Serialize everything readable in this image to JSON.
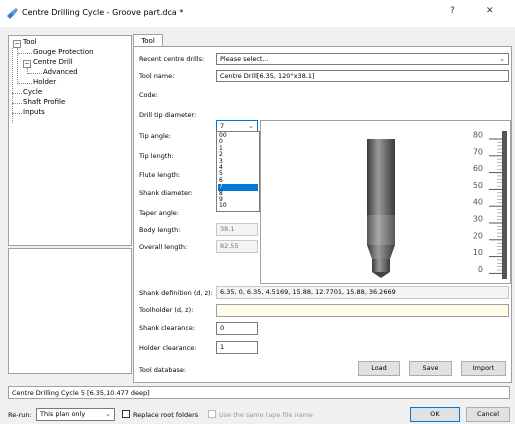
{
  "window": {
    "title": "Centre Drilling Cycle - Groove part.dca *",
    "help_label": "?",
    "close_label": "✕"
  },
  "tree": {
    "items": [
      {
        "label": "Tool"
      },
      {
        "label": "Gouge Protection"
      },
      {
        "label": "Centre Drill"
      },
      {
        "label": "Advanced"
      },
      {
        "label": "Holder"
      },
      {
        "label": "Cycle"
      },
      {
        "label": "Shaft Profile"
      },
      {
        "label": "Inputs"
      }
    ],
    "collapse_glyph": "−"
  },
  "tab": {
    "label": "Tool"
  },
  "form": {
    "recent_label": "Recent centre drills:",
    "recent_value": "Please select...",
    "tool_name_label": "Tool name:",
    "tool_name_value": "Centre Drill[6.35, 120°x38.1]",
    "code_label": "Code:",
    "code_value": "7",
    "drill_tip_label": "Drill tip diameter:",
    "tip_angle_label": "Tip angle:",
    "tip_length_label": "Tip length:",
    "flute_length_label": "Flute length:",
    "shank_diameter_label": "Shank diameter:",
    "taper_angle_label": "Taper angle:",
    "body_length_label": "Body length:",
    "body_length_value": "38.1",
    "overall_length_label": "Overall length:",
    "overall_length_value": "82.55",
    "shank_def_label": "Shank definition (d, z):",
    "shank_def_value": "6.35, 0, 6.35, 4.5169, 15.88, 12.7701, 15.88, 36.2669",
    "toolholder_label": "Toolholder (d, z):",
    "toolholder_value": "",
    "shank_clearance_label": "Shank clearance:",
    "shank_clearance_value": "0",
    "holder_clearance_label": "Holder clearance:",
    "holder_clearance_value": "1",
    "tool_database_label": "Tool database:"
  },
  "code_options": [
    "00",
    "0",
    "1",
    "2",
    "3",
    "4",
    "5",
    "6",
    "7",
    "8",
    "9",
    "10"
  ],
  "code_selected": "7",
  "ruler": {
    "labels": [
      "80",
      "70",
      "60",
      "50",
      "40",
      "30",
      "20",
      "10",
      "0"
    ]
  },
  "buttons": {
    "load": "Load",
    "save": "Save",
    "import": "Import",
    "ok": "OK",
    "cancel": "Cancel"
  },
  "status_text": "Centre Drilling Cycle 5 [6.35,10.477 deep]",
  "footer": {
    "rerun_label": "Re-run:",
    "rerun_value": "This plan only",
    "replace_root_label": "Replace root folders",
    "same_tape_label": "Use the same tape file name"
  },
  "colors": {
    "accent": "#0078d7",
    "selection": "#0078d7",
    "toolholder_bg": "#fffde6"
  },
  "icons": {
    "app": "drill-app-icon",
    "dropdown": "chevron-down-icon"
  }
}
